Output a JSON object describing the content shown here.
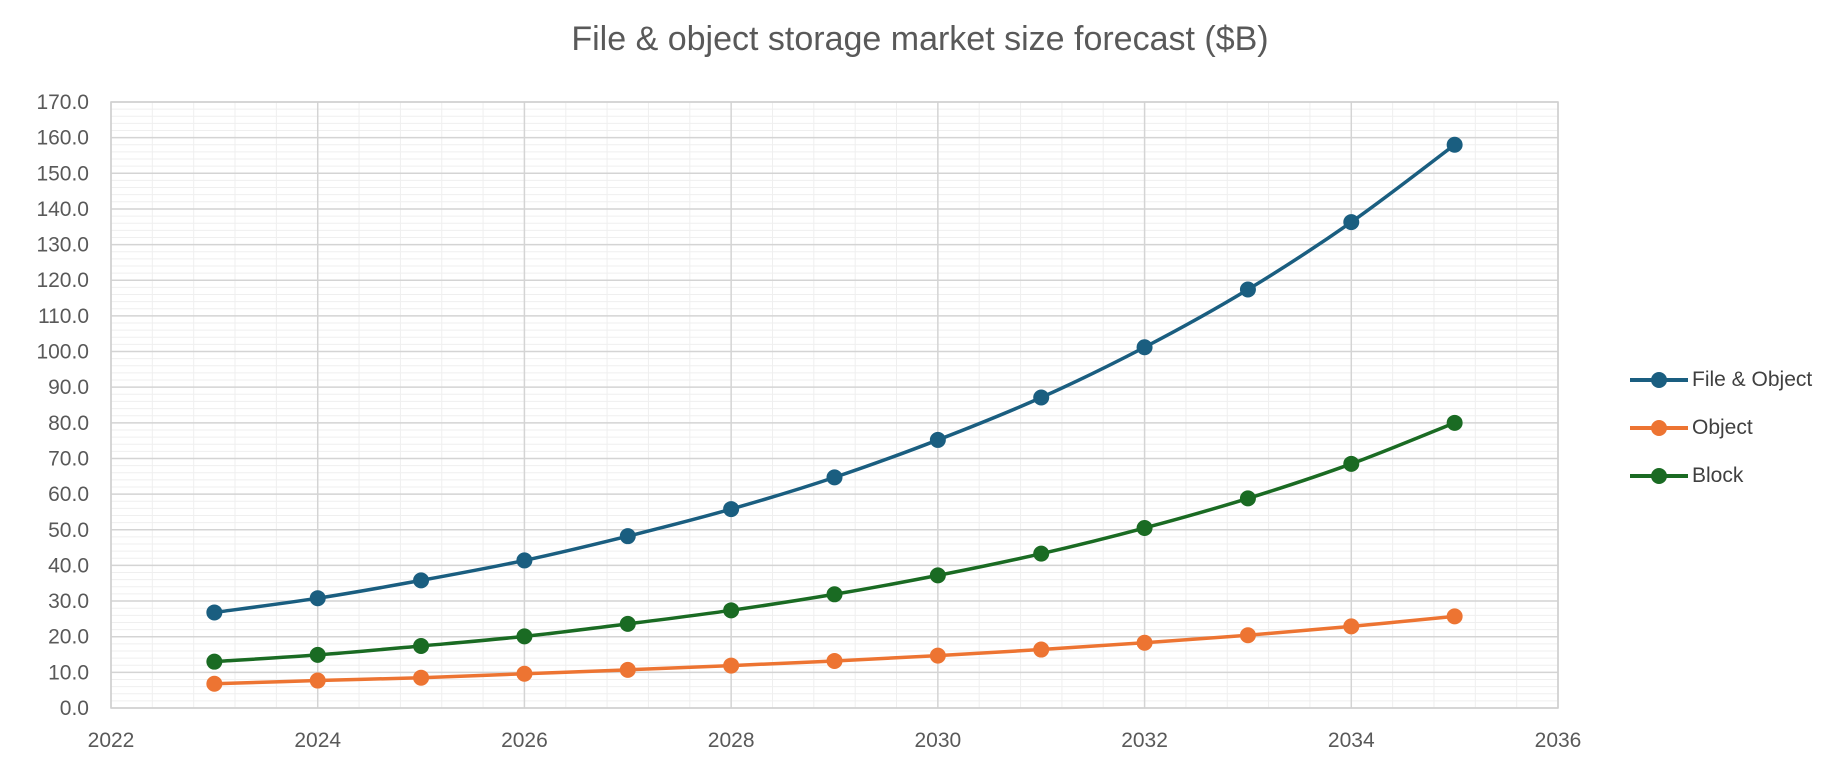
{
  "chart_data": {
    "type": "scatter",
    "title": "File & object storage market size forecast ($B)",
    "xlabel": "",
    "ylabel": "",
    "xlim": [
      2022,
      2036
    ],
    "ylim": [
      0,
      170
    ],
    "x_ticks": [
      "2022",
      "2024",
      "2026",
      "2028",
      "2030",
      "2032",
      "2034",
      "2036"
    ],
    "y_ticks": [
      "0.0",
      "10.0",
      "20.0",
      "30.0",
      "40.0",
      "50.0",
      "60.0",
      "70.0",
      "80.0",
      "90.0",
      "100.0",
      "110.0",
      "120.0",
      "130.0",
      "140.0",
      "150.0",
      "160.0",
      "170.0"
    ],
    "grid": true,
    "legend_position": "right",
    "x": [
      2023,
      2024,
      2025,
      2026,
      2027,
      2028,
      2029,
      2030,
      2031,
      2032,
      2033,
      2034,
      2035
    ],
    "series": [
      {
        "name": "File & Object",
        "color": "#1a5e80",
        "values": [
          26.8,
          30.8,
          35.8,
          41.4,
          48.2,
          55.8,
          64.7,
          75.2,
          87.1,
          101.2,
          117.4,
          136.3,
          158.0
        ]
      },
      {
        "name": "Object",
        "color": "#ed7432",
        "values": [
          6.8,
          7.7,
          8.5,
          9.6,
          10.7,
          11.9,
          13.2,
          14.7,
          16.4,
          18.3,
          20.4,
          22.9,
          25.7
        ]
      },
      {
        "name": "Block",
        "color": "#1a6b23",
        "values": [
          13.0,
          14.9,
          17.4,
          20.1,
          23.6,
          27.4,
          31.9,
          37.2,
          43.3,
          50.5,
          58.8,
          68.5,
          80.0
        ]
      }
    ]
  }
}
